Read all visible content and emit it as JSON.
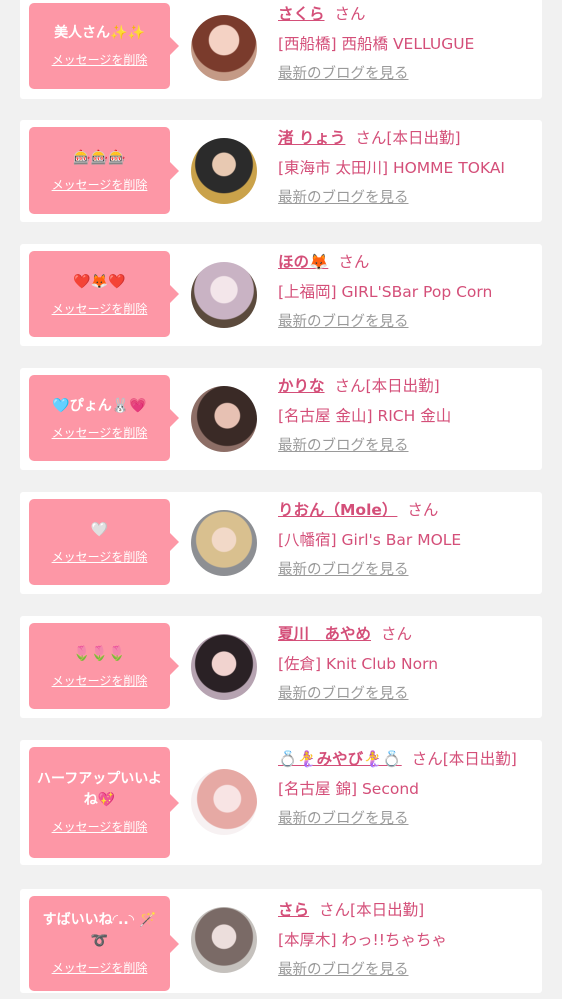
{
  "delete_label": "メッセージを削除",
  "blog_label": "最新のブログを見る",
  "honorific": "さん",
  "cards": [
    {
      "message": "美人さん✨✨",
      "name": "さくら",
      "status": "",
      "shop": "[西船橋] 西船橋 VELLUGUE"
    },
    {
      "message": "🎰🎰🎰",
      "name": "渚 りょう",
      "status": "[本日出勤]",
      "shop": "[東海市 太田川] HOMME TOKAI"
    },
    {
      "message": "❤️🦊❤️",
      "name": "ほの🦊",
      "status": "",
      "shop": "[上福岡] GIRL'SBar Pop Corn"
    },
    {
      "message": "🩵ぴょん🐰💗",
      "name": "かりな",
      "status": "[本日出勤]",
      "shop": "[名古屋 金山] RICH 金山"
    },
    {
      "message": "🤍",
      "name": "りおん（Mole）",
      "status": "",
      "shop": "[八幡宿] Girl's Bar MOLE"
    },
    {
      "message": "🌷🌷🌷",
      "name": "夏川　あやめ",
      "status": "",
      "shop": "[佐倉] Knit Club Norn"
    },
    {
      "message": "ハーフアップいいよね💖",
      "name": "💍🧜‍♀️みやび🧜‍♀️💍",
      "status": "[本日出勤]",
      "shop": "[名古屋 錦] Second"
    },
    {
      "message": "すばいいね◜..◝ 🪄➰",
      "name": "さら",
      "status": "[本日出勤]",
      "shop": "[本厚木] わっ!!ちゃちゃ"
    }
  ],
  "colors": {
    "accent": "#d44f79",
    "bubble": "#fd97a6",
    "link_gray": "#9a9a9a",
    "background": "#f1f1f1"
  }
}
